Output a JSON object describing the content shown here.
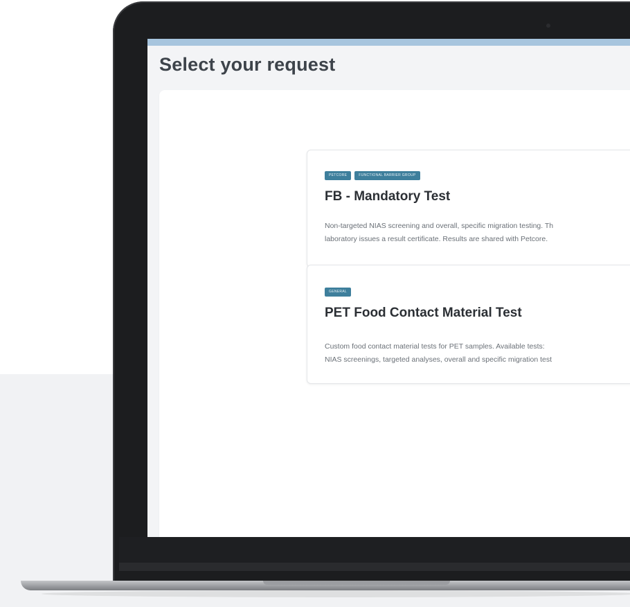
{
  "page": {
    "title": "Select your request"
  },
  "requests": [
    {
      "tags": [
        "PETCORE",
        "FUNCTIONAL BARRIER GROUP"
      ],
      "title": "FB - Mandatory Test",
      "description_lines": [
        "Non-targeted NIAS screening and overall, specific migration testing. Th",
        "laboratory issues a result certificate. Results are shared with Petcore."
      ]
    },
    {
      "tags": [
        "GENERAL"
      ],
      "title": "PET Food Contact Material Test",
      "description_lines": [
        "Custom food contact material tests for PET samples. Available tests:",
        "NIAS screenings, targeted analyses, overall and specific migration test"
      ]
    }
  ],
  "colors": {
    "tag_background": "#3e7f9c",
    "top_accent_bar": "#a7c5de"
  }
}
